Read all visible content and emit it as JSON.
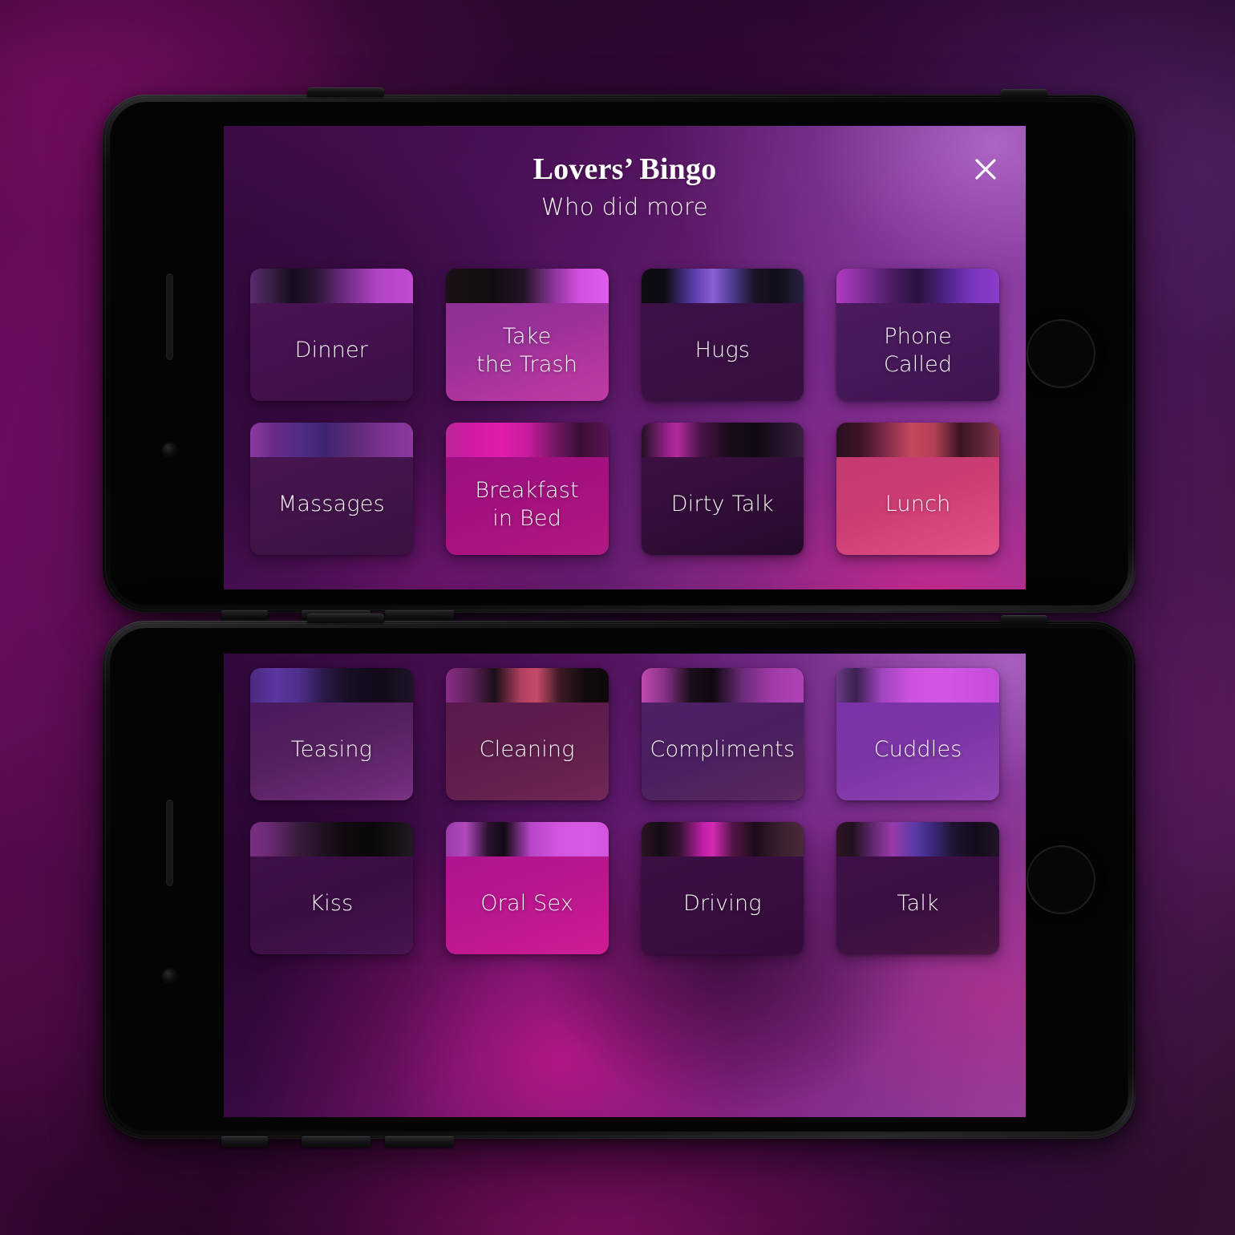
{
  "app": {
    "title": "Lovers’ Bingo",
    "subtitle": "Who did more",
    "close_icon": "close-icon",
    "accent": "#c41f93",
    "screen_purple": "#5d1a69"
  },
  "phones": [
    {
      "name": "phone-top",
      "header_visible": true,
      "cards": [
        {
          "label": "Dinner",
          "strip": "linear-gradient(90deg,#5b2a72 0%,#3a2147 12%,#140d1c 26%,#2b1434 40%,#6e2a82 58%,#b044c4 78%,#c24ad2 100%)",
          "body": "linear-gradient(160deg,#4a1354 0%,#451150 45%,#3b0f46 100%)"
        },
        {
          "label": "Take\nthe Trash",
          "strip": "linear-gradient(90deg,#1a1118 0%,#120c12 30%,#241426 48%,#8a3399 66%,#d34fe0 82%,#e05ceb 100%)",
          "body": "linear-gradient(160deg,#8d2f93 0%,#9b3199 40%,#b5369f 75%,#c03ba4 100%)"
        },
        {
          "label": "Hugs",
          "strip": "linear-gradient(90deg,#100c14 0%,#0d0a11 14%,#5a3ba8 32%,#8a5fd6 44%,#4f3a92 56%,#1a1224 70%,#120d18 84%,#2a2045 100%)",
          "body": "linear-gradient(160deg,#3d1148 0%,#3a1044 48%,#350f3e 100%)"
        },
        {
          "label": "Phone\nCalled",
          "strip": "linear-gradient(90deg,#b03ac0 0%,#8a2fa0 14%,#4a1d63 34%,#2a1240 50%,#50248a 68%,#7b36c0 84%,#8c3ccb 100%)",
          "body": "linear-gradient(160deg,#4b1a5e 0%,#46185a 46%,#3e1450 100%)"
        }
      ],
      "cards_row2": [
        {
          "label": "Massages",
          "strip": "linear-gradient(90deg,#8a3aa0 0%,#6a2b8a 14%,#4d2d86 32%,#3e2472 46%,#5c2a72 62%,#7b3290 82%,#8c38a0 100%)",
          "body": "linear-gradient(160deg,#47154f 0%,#43144b 46%,#3a1143 100%)"
        },
        {
          "label": "Breakfast\nin Bed",
          "strip": "linear-gradient(90deg,#b8269a 0%,#d31aa5 16%,#e01dab 34%,#c91b9c 50%,#7a1868 66%,#3a0f36 82%,#5a1452 100%)",
          "body": "linear-gradient(160deg,#9c1080 0%,#a3117f 44%,#ae1580 80%,#b01a82 100%)"
        },
        {
          "label": "Dirty Talk",
          "strip": "linear-gradient(90deg,#231024 0%,#8a1f80 14%,#b42aa0 22%,#4c1348 36%,#180c1a 54%,#100a12 72%,#2a1630 90%,#3a1e40 100%)",
          "body": "linear-gradient(160deg,#3b1042 0%,#330e3a 48%,#240a2a 100%)"
        },
        {
          "label": "Lunch",
          "strip": "linear-gradient(90deg,#2a1020 0%,#3a1226 14%,#7e2a4a 30%,#c5485f 46%,#b23f55 60%,#3a1424 76%,#6a2840 92%,#8a3550 100%)",
          "body": "linear-gradient(160deg,#c43a72 0%,#cc3d74 45%,#dd4a80 82%,#e2528a 100%)"
        }
      ]
    },
    {
      "name": "phone-bottom",
      "header_visible": false,
      "cards": [
        {
          "label": "Teasing",
          "strip": "linear-gradient(90deg,#4a2a80 0%,#5a36a0 16%,#4e2f8c 30%,#2a1845 46%,#160e22 62%,#120a18 80%,#1e1428 100%)",
          "body": "linear-gradient(160deg,#4a1a5e 0%,#55205f 45%,#6b2a75 82%,#7a3382 100%)"
        },
        {
          "label": "Cleaning",
          "strip": "linear-gradient(90deg,#8a2d88 0%,#5c2058 16%,#1a0f18 30%,#b04060 46%,#c44a68 56%,#3a1a24 70%,#120a10 86%,#0d080c 100%)",
          "body": "linear-gradient(160deg,#5a1a4e 0%,#5e1d4c 46%,#6a2450 82%,#73285a 100%)"
        },
        {
          "label": "Compliments",
          "strip": "linear-gradient(90deg,#c04ab0 0%,#8a3088 14%,#1a0f1c 30%,#0e080f 44%,#6a2a78 62%,#a03aa8 80%,#b043b4 100%)",
          "body": "linear-gradient(160deg,#4e2166 0%,#4a1f60 46%,#55255f 82%,#5e2a62 100%)"
        },
        {
          "label": "Cuddles",
          "strip": "linear-gradient(90deg,#6a3a86 0%,#3a2050 12%,#a045c0 28%,#cc52dd 46%,#d355e4 66%,#cb4fde 84%,#c54ad8 100%)",
          "body": "linear-gradient(160deg,#7a33a8 0%,#7c35a6 45%,#8a3fae 82%,#9246b4 100%)"
        }
      ],
      "cards_row2": [
        {
          "label": "Kiss",
          "strip": "linear-gradient(90deg,#7a2f82 0%,#6a2a74 12%,#3c1c3e 28%,#241426 42%,#100a10 58%,#0a060a 76%,#221a22 100%)",
          "body": "linear-gradient(160deg,#3e0f48 0%,#3a0e43 46%,#42124a 82%,#49164f 100%)"
        },
        {
          "label": "Oral Sex",
          "strip": "linear-gradient(90deg,#9a3aa8 0%,#b248be 12%,#2a1230 26%,#120a14 36%,#b645c8 52%,#d455e0 70%,#d85ae4 86%,#d054dd 100%)",
          "body": "linear-gradient(160deg,#b01490 0%,#b8168e 44%,#c81a92 82%,#cf1e96 100%)"
        },
        {
          "label": "Driving",
          "strip": "linear-gradient(90deg,#2a1424 0%,#140c14 12%,#3a1236 24%,#c020a8 38%,#d42ab4 44%,#561548 56%,#1c0c1a 70%,#3a2030 86%,#4a2a3a 100%)",
          "body": "linear-gradient(160deg,#3c0f44 0%,#390e40 46%,#330c3a 100%)"
        },
        {
          "label": "Talk",
          "strip": "linear-gradient(90deg,#2e1426 0%,#20121f 10%,#6a2a78 24%,#9a3aaa 34%,#5a3aa8 48%,#3e2a80 58%,#1e1430 72%,#120c1c 86%,#221428 100%)",
          "body": "linear-gradient(160deg,#3f1048 0%,#3b0f43 46%,#431340 82%,#4c1742 100%)"
        }
      ]
    }
  ],
  "hardware": {
    "home_button": "home-button",
    "speaker": "speaker-grill",
    "camera": "front-camera",
    "power_button": "power-button",
    "volume_up": "volume-up-button",
    "volume_down": "volume-down-button",
    "mute_switch": "mute-switch"
  }
}
